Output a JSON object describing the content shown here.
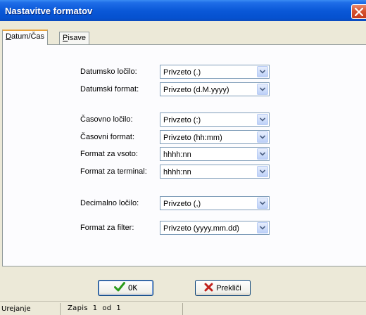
{
  "window": {
    "title": "Nastavitve formatov"
  },
  "tabs": [
    {
      "label": "Datum/Čas",
      "accel": "D",
      "rest": "atum/Čas"
    },
    {
      "label": "Pisave",
      "accel": "P",
      "rest": "isave"
    }
  ],
  "fields": [
    {
      "label": "Datumsko ločilo:",
      "value": "Privzeto (.)"
    },
    {
      "label": "Datumski format:",
      "value": "Privzeto (d.M.yyyy)"
    },
    {
      "label": "Časovno ločilo:",
      "value": "Privzeto (:)"
    },
    {
      "label": "Časovni format:",
      "value": "Privzeto (hh:mm)"
    },
    {
      "label": "Format za vsoto:",
      "value": "hhhh:nn"
    },
    {
      "label": "Format za terminal:",
      "value": "hhhh:nn"
    },
    {
      "label": "Decimalno ločilo:",
      "value": "Privzeto (,)"
    },
    {
      "label": "Format za filter:",
      "value": "Privzeto (yyyy.mm.dd)"
    }
  ],
  "buttons": {
    "ok_label": "OK",
    "cancel_label": "Prekliči"
  },
  "statusbar": {
    "mode": "Urejanje",
    "record": "Zapis  1  od  1"
  },
  "colors": {
    "titlebar": "#0a58d8",
    "window_bg": "#ece9d8",
    "ok_icon": "#2a9b1a",
    "cancel_icon": "#c0211c"
  }
}
